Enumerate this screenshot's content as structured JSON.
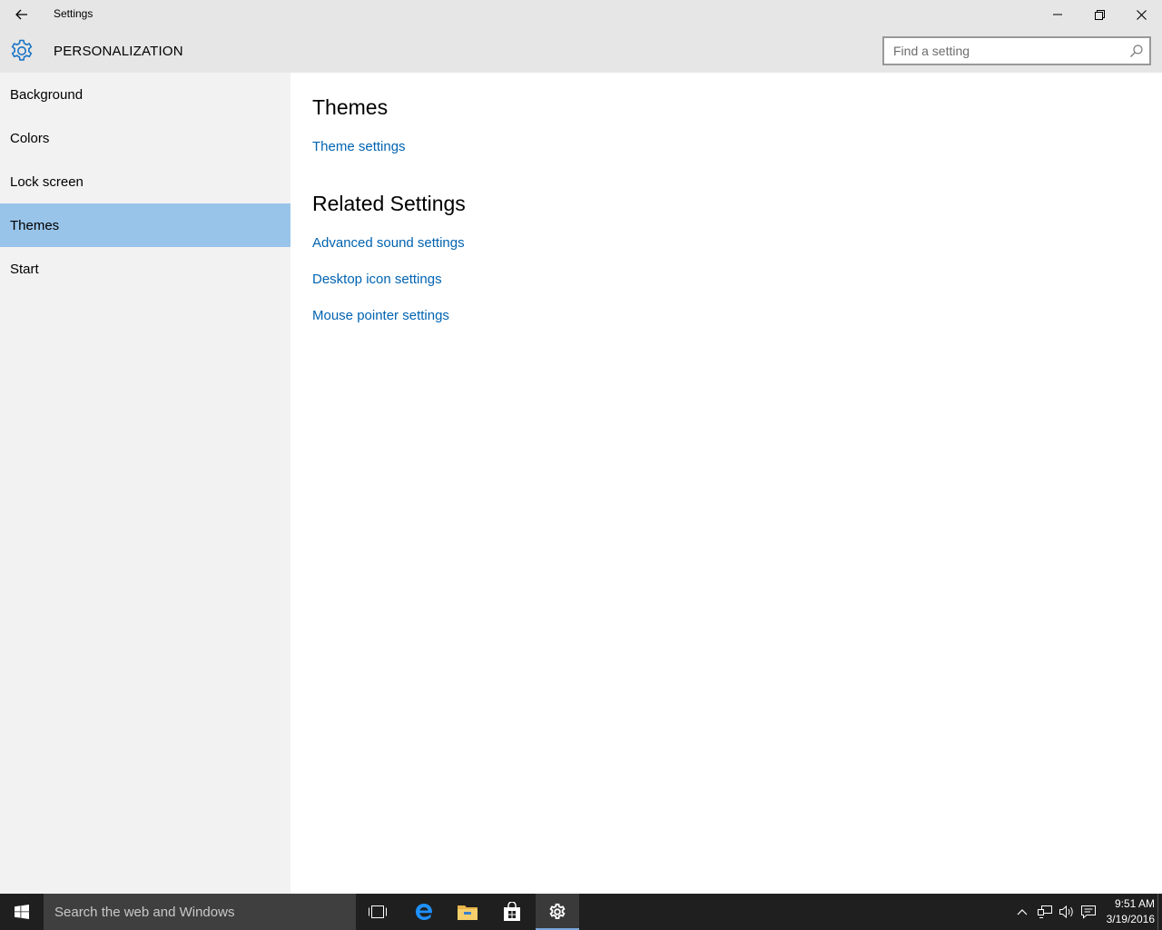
{
  "window": {
    "title": "Settings",
    "back_icon": "back-arrow-icon",
    "minimize_icon": "minimize-icon",
    "maximize_icon": "restore-icon",
    "close_icon": "close-icon"
  },
  "header": {
    "icon": "gear-icon",
    "title": "PERSONALIZATION",
    "search_placeholder": "Find a setting",
    "search_value": ""
  },
  "sidebar": {
    "items": [
      {
        "label": "Background",
        "selected": false
      },
      {
        "label": "Colors",
        "selected": false
      },
      {
        "label": "Lock screen",
        "selected": false
      },
      {
        "label": "Themes",
        "selected": true
      },
      {
        "label": "Start",
        "selected": false
      }
    ],
    "selected_color": "#99c4ea"
  },
  "main": {
    "themes_title": "Themes",
    "theme_settings_link": "Theme settings",
    "related_title": "Related Settings",
    "related_links": [
      "Advanced sound settings",
      "Desktop icon settings",
      "Mouse pointer settings"
    ],
    "link_color": "#0063b1"
  },
  "taskbar": {
    "search_placeholder": "Search the web and Windows",
    "pinned": [
      "task-view-icon",
      "edge-icon",
      "file-explorer-icon",
      "store-icon",
      "settings-icon"
    ],
    "active": "settings-icon",
    "tray": [
      "chevron-up-icon",
      "network-icon",
      "volume-icon",
      "action-center-icon"
    ],
    "time": "9:51 AM",
    "date": "3/19/2016"
  }
}
